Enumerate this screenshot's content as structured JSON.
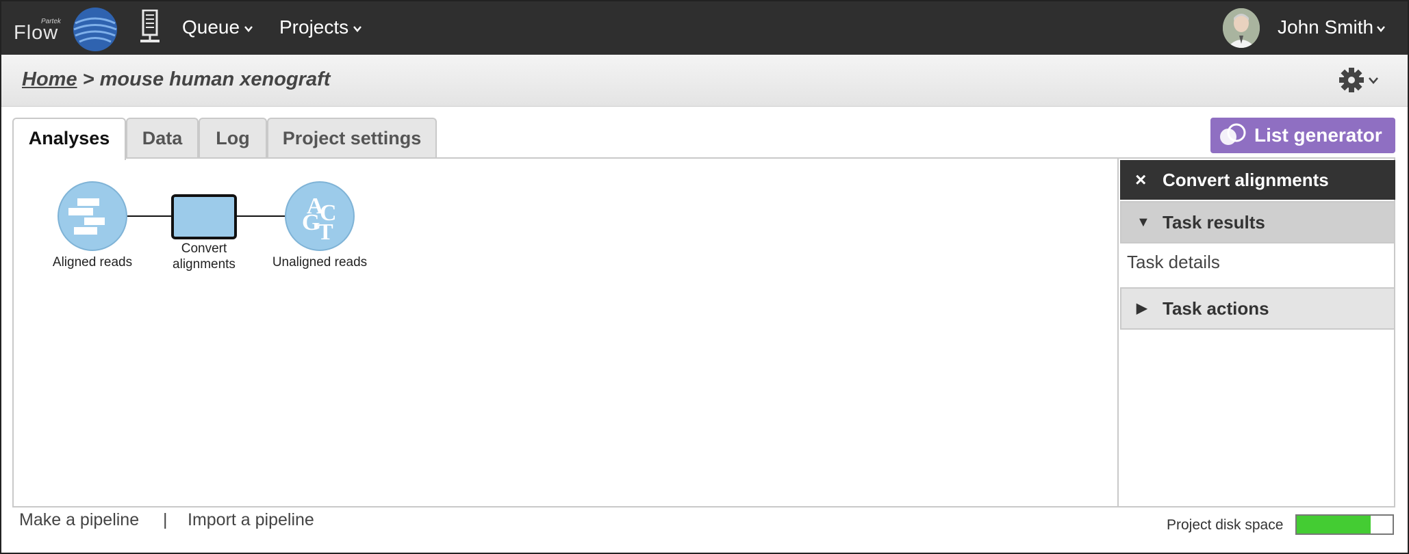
{
  "app": {
    "brand_small": "Partek",
    "brand_name": "Flow"
  },
  "navbar": {
    "queue_label": "Queue",
    "projects_label": "Projects",
    "user_name": "John Smith"
  },
  "breadcrumb": {
    "home_label": "Home",
    "separator": " > ",
    "project_name": "mouse human xenograft"
  },
  "tabs": [
    {
      "label": "Analyses",
      "active": true
    },
    {
      "label": "Data",
      "active": false
    },
    {
      "label": "Log",
      "active": false
    },
    {
      "label": "Project settings",
      "active": false
    }
  ],
  "list_generator": {
    "label": "List generator",
    "color": "#8f6fc2"
  },
  "pipeline": {
    "nodes": [
      {
        "label": "Aligned reads",
        "kind": "data",
        "icon": "aligned-reads-icon"
      },
      {
        "label": "Convert\nalignments",
        "kind": "task",
        "icon": "task-box"
      },
      {
        "label": "Unaligned reads",
        "kind": "data",
        "icon": "acgt-icon"
      }
    ],
    "node_color": "#9ccbea"
  },
  "task_panel": {
    "close_symbol": "×",
    "title": "Convert alignments",
    "results_label": "Task results",
    "details_label": "Task details",
    "actions_label": "Task actions"
  },
  "footer": {
    "make_pipeline": "Make a pipeline",
    "separator": "|",
    "import_pipeline": "Import a pipeline",
    "disk_space_label": "Project disk space",
    "disk_usage_fraction": 0.77,
    "disk_color": "#44cc33"
  }
}
